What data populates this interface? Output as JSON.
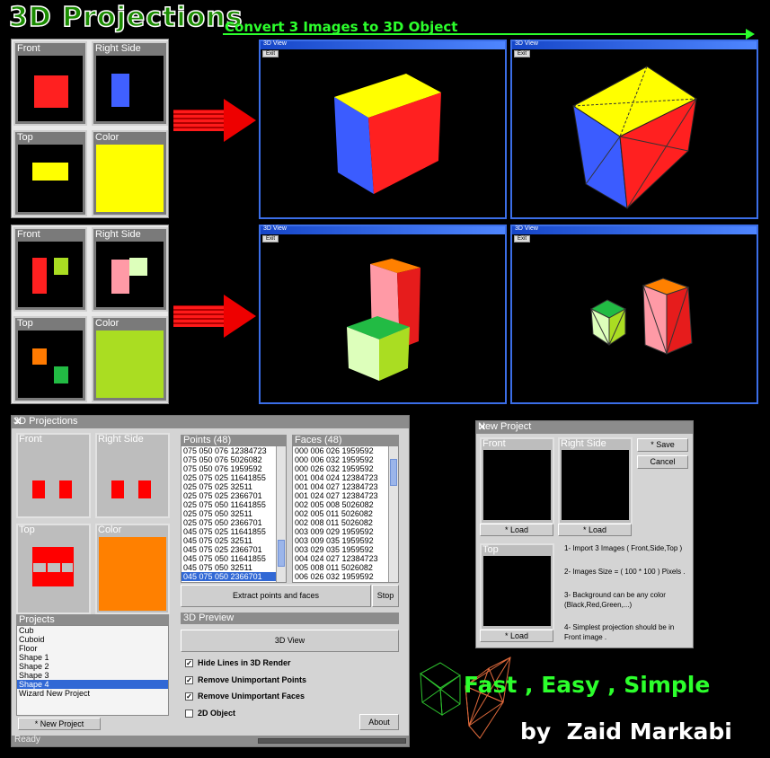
{
  "header": {
    "title": "3D Projections",
    "subtitle": "Convert 3 Images to 3D Object"
  },
  "examples": {
    "labels": {
      "front": "Front",
      "right": "Right Side",
      "top": "Top",
      "color": "Color"
    },
    "view_title": "3D View",
    "exit_label": "Exit",
    "colors": {
      "red": "#ff2020",
      "blue": "#4060ff",
      "yellow": "#ffff00",
      "green_lime": "#aadd22",
      "orange": "#ff8000"
    }
  },
  "main_window": {
    "title": "3D Projections",
    "labels": {
      "front": "Front",
      "right": "Right Side",
      "top": "Top",
      "color": "Color"
    },
    "points_header": "Points (48)",
    "faces_header": "Faces (48)",
    "points": [
      "075 050 076 12384723",
      "075 050 076 5026082",
      "075 050 076 1959592",
      "025 075 025 11641855",
      "025 075 025 32511",
      "025 075 025 2366701",
      "025 075 050 11641855",
      "025 075 050 32511",
      "025 075 050 2366701",
      "045 075 025 11641855",
      "045 075 025 32511",
      "045 075 025 2366701",
      "045 075 050 11641855",
      "045 075 050 32511",
      "045 075 050 2366701"
    ],
    "faces": [
      "000 006 026 1959592",
      "000 006 032 1959592",
      "000 026 032 1959592",
      "001 004 024 12384723",
      "001 004 027 12384723",
      "001 024 027 12384723",
      "002 005 008 5026082",
      "002 005 011 5026082",
      "002 008 011 5026082",
      "003 009 029 1959592",
      "003 009 035 1959592",
      "003 029 035 1959592",
      "004 024 027 12384723",
      "005 008 011 5026082",
      "006 026 032 1959592"
    ],
    "extract_button": "Extract points and faces",
    "stop_button": "Stop",
    "projects_header": "Projects",
    "projects": [
      "Cub",
      "Cuboid",
      "Floor",
      "Shape 1",
      "Shape 2",
      "Shape 3",
      "Shape 4",
      "Wizard New Project"
    ],
    "selected_project": "Shape 4",
    "new_project_button": "* New Project",
    "preview_header": "3D Preview",
    "view_button": "3D View",
    "options": [
      {
        "label": "Hide Lines in 3D Render",
        "checked": true
      },
      {
        "label": "Remove Unimportant Points",
        "checked": true
      },
      {
        "label": "Remove Unimportant Faces",
        "checked": true
      },
      {
        "label": "2D Object",
        "checked": false
      }
    ],
    "about_button": "About",
    "status": "Ready",
    "check_mark": "✓"
  },
  "new_project": {
    "title": "New Project",
    "front_label": "Front",
    "right_label": "Right Side",
    "top_label": "Top",
    "save_button": "* Save",
    "cancel_button": "Cancel",
    "load_label": "* Load",
    "instructions": [
      "1- Import 3 Images ( Front,Side,Top )",
      "2- Images Size = ( 100 * 100 ) Pixels .",
      "3- Background can be any color (Black,Red,Green,...)",
      "4- Simplest projection should be in Front image ."
    ]
  },
  "footer": {
    "slogan_fast": "Fast",
    "slogan_sep1": " , ",
    "slogan_easy": "Easy",
    "slogan_sep2": " , ",
    "slogan_simple": "Simple",
    "byline": "by  Zaid Markabi"
  }
}
